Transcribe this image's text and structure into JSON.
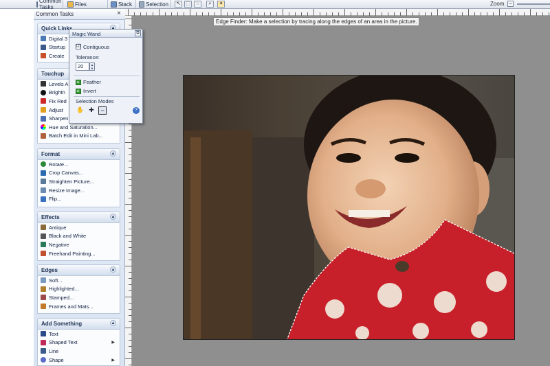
{
  "toolbar": {
    "tabs": [
      {
        "label": "Common Tasks",
        "icon": "common-tasks-icon"
      },
      {
        "label": "Files",
        "icon": "files-icon"
      },
      {
        "label": "Stack",
        "icon": "stack-icon"
      },
      {
        "label": "Selection",
        "icon": "selection-icon"
      }
    ],
    "zoom_label": "Zoom",
    "zoom_minus": "−"
  },
  "pane": {
    "title": "Common Tasks",
    "close": "×",
    "groups": [
      {
        "title": "Quick Links",
        "items": [
          {
            "label": "Digital 3",
            "icon": "camera-icon",
            "color": "#4a7ab5"
          },
          {
            "label": "Startup",
            "icon": "startup-icon",
            "color": "#3b5a8a"
          },
          {
            "label": "Create",
            "icon": "create-icon",
            "color": "#c94f2a"
          }
        ]
      },
      {
        "title": "Touchup",
        "items": [
          {
            "label": "Levels A",
            "icon": "levels-icon",
            "color": "#333333"
          },
          {
            "label": "Brightn",
            "icon": "brightness-icon",
            "color": "#111111"
          },
          {
            "label": "Fix Red",
            "icon": "red-eye-icon",
            "color": "#cc2a2a"
          },
          {
            "label": "Adjust",
            "icon": "adjust-icon",
            "color": "#e0a020"
          },
          {
            "label": "Sharpen",
            "icon": "sharpen-icon",
            "color": "#4a6fb0"
          },
          {
            "label": "Hue and Saturation...",
            "icon": "hue-icon",
            "color": "#8a4fc4"
          },
          {
            "label": "Batch Edit in Mini Lab...",
            "icon": "batch-icon",
            "color": "#b0603a"
          }
        ]
      },
      {
        "title": "Format",
        "items": [
          {
            "label": "Rotate...",
            "icon": "rotate-icon",
            "color": "#2e8a3a"
          },
          {
            "label": "Crop Canvas...",
            "icon": "crop-icon",
            "color": "#2a6ab0"
          },
          {
            "label": "Straighten Picture...",
            "icon": "straighten-icon",
            "color": "#5a7a9a"
          },
          {
            "label": "Resize Image...",
            "icon": "resize-icon",
            "color": "#6a8ab0"
          },
          {
            "label": "Flip...",
            "icon": "flip-icon",
            "color": "#3a70c0"
          }
        ]
      },
      {
        "title": "Effects",
        "items": [
          {
            "label": "Antique",
            "icon": "antique-icon",
            "color": "#8a6a3a"
          },
          {
            "label": "Black and White",
            "icon": "black-white-icon",
            "color": "#555555"
          },
          {
            "label": "Negative",
            "icon": "negative-icon",
            "color": "#2a7a5a"
          },
          {
            "label": "Freehand Painting...",
            "icon": "painting-icon",
            "color": "#c05030"
          }
        ]
      },
      {
        "title": "Edges",
        "items": [
          {
            "label": "Soft...",
            "icon": "soft-edge-icon",
            "color": "#7a9ac0"
          },
          {
            "label": "Highlighted...",
            "icon": "highlighted-icon",
            "color": "#b08030"
          },
          {
            "label": "Stamped...",
            "icon": "stamped-icon",
            "color": "#9a4a4a"
          },
          {
            "label": "Frames and Mats...",
            "icon": "frames-icon",
            "color": "#c07a2a"
          }
        ]
      },
      {
        "title": "Add Something",
        "items": [
          {
            "label": "Text",
            "icon": "text-icon",
            "color": "#2a4a8a",
            "arrow": ""
          },
          {
            "label": "Shaped Text",
            "icon": "shaped-text-icon",
            "color": "#c02a5a",
            "arrow": "▶"
          },
          {
            "label": "Line",
            "icon": "line-icon",
            "color": "#3a5a8a",
            "arrow": ""
          },
          {
            "label": "Shape",
            "icon": "shape-icon",
            "color": "#5a6ac8",
            "arrow": "▶"
          }
        ]
      }
    ]
  },
  "tooltip": "Edge Finder: Make a selection by tracing along the edges of an area in the picture.",
  "wand": {
    "title": "Magic Wand",
    "contiguous_label": "Contiguous",
    "contiguous_checked": "☑",
    "tolerance_label": "Tolerance:",
    "tolerance_value": "20",
    "feather_label": "Feather",
    "invert_label": "Invert",
    "modes_label": "Selection Modes"
  },
  "colors": {
    "pane_bg": "#dfe7f3",
    "workspace": "#8f8f8f",
    "sweater": "#c8202a"
  }
}
